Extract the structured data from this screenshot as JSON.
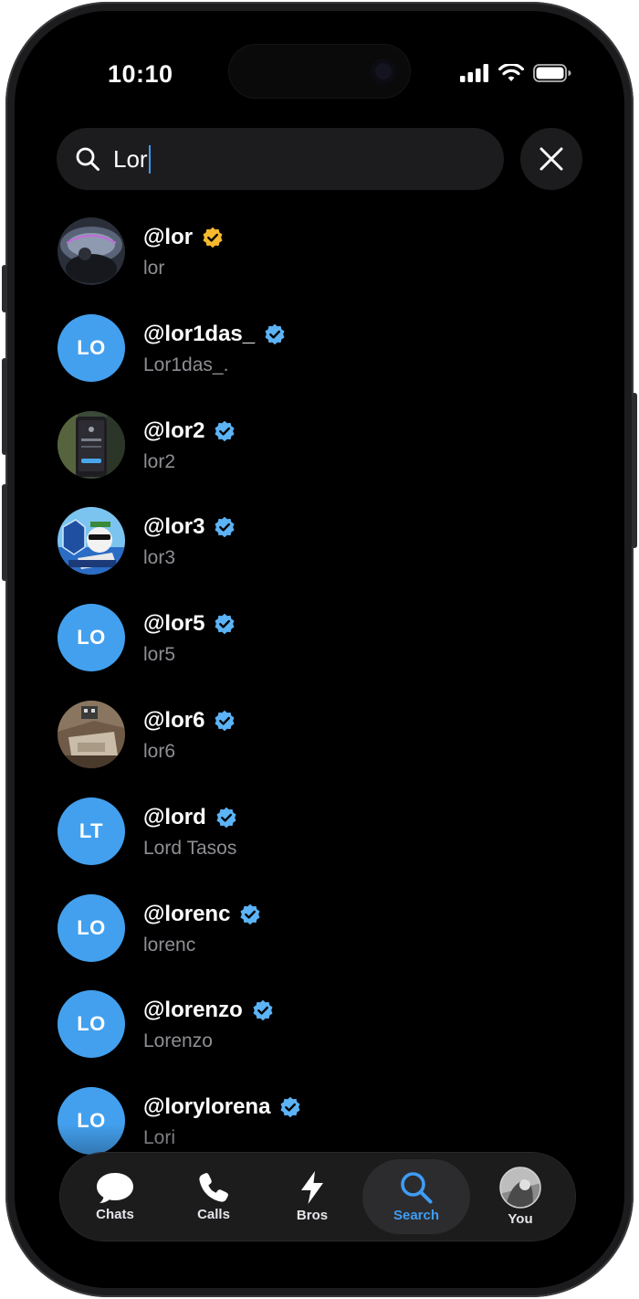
{
  "status_bar": {
    "time": "10:10"
  },
  "search": {
    "query": "Lor",
    "close_icon": "x-icon",
    "search_icon": "magnifier-icon"
  },
  "results": [
    {
      "handle": "@lor",
      "name": "lor",
      "verified_color": "#f5b82e",
      "avatar": {
        "type": "photo",
        "desc": "photo-avatar"
      }
    },
    {
      "handle": "@lor1das_",
      "name": "Lor1das_.",
      "verified_color": "#5cb3f5",
      "avatar": {
        "type": "initials",
        "initials": "LO"
      }
    },
    {
      "handle": "@lor2",
      "name": "lor2",
      "verified_color": "#5cb3f5",
      "avatar": {
        "type": "photo",
        "desc": "photo-avatar"
      }
    },
    {
      "handle": "@lor3",
      "name": "lor3",
      "verified_color": "#5cb3f5",
      "avatar": {
        "type": "photo",
        "desc": "cartoon-avatar"
      }
    },
    {
      "handle": "@lor5",
      "name": "lor5",
      "verified_color": "#5cb3f5",
      "avatar": {
        "type": "initials",
        "initials": "LO"
      }
    },
    {
      "handle": "@lor6",
      "name": "lor6",
      "verified_color": "#5cb3f5",
      "avatar": {
        "type": "photo",
        "desc": "photo-avatar"
      }
    },
    {
      "handle": "@lord",
      "name": "Lord Tasos",
      "verified_color": "#5cb3f5",
      "avatar": {
        "type": "initials",
        "initials": "LT"
      }
    },
    {
      "handle": "@lorenc",
      "name": "lorenc",
      "verified_color": "#5cb3f5",
      "avatar": {
        "type": "initials",
        "initials": "LO"
      }
    },
    {
      "handle": "@lorenzo",
      "name": "Lorenzo",
      "verified_color": "#5cb3f5",
      "avatar": {
        "type": "initials",
        "initials": "LO"
      }
    },
    {
      "handle": "@lorylorena",
      "name": "Lori",
      "verified_color": "#5cb3f5",
      "avatar": {
        "type": "initials",
        "initials": "LO"
      }
    }
  ],
  "tab_bar": {
    "tabs": [
      {
        "label": "Chats",
        "icon": "chat-bubble-icon",
        "active": false
      },
      {
        "label": "Calls",
        "icon": "phone-icon",
        "active": false
      },
      {
        "label": "Bros",
        "icon": "lightning-icon",
        "active": false
      },
      {
        "label": "Search",
        "icon": "magnifier-icon",
        "active": true
      },
      {
        "label": "You",
        "icon": "profile-avatar",
        "active": false
      }
    ]
  },
  "colors": {
    "accent": "#3e9df5",
    "avatar_bg": "#43a0ee",
    "gold_badge": "#f5b82e",
    "blue_badge": "#5cb3f5",
    "background": "#000000"
  }
}
